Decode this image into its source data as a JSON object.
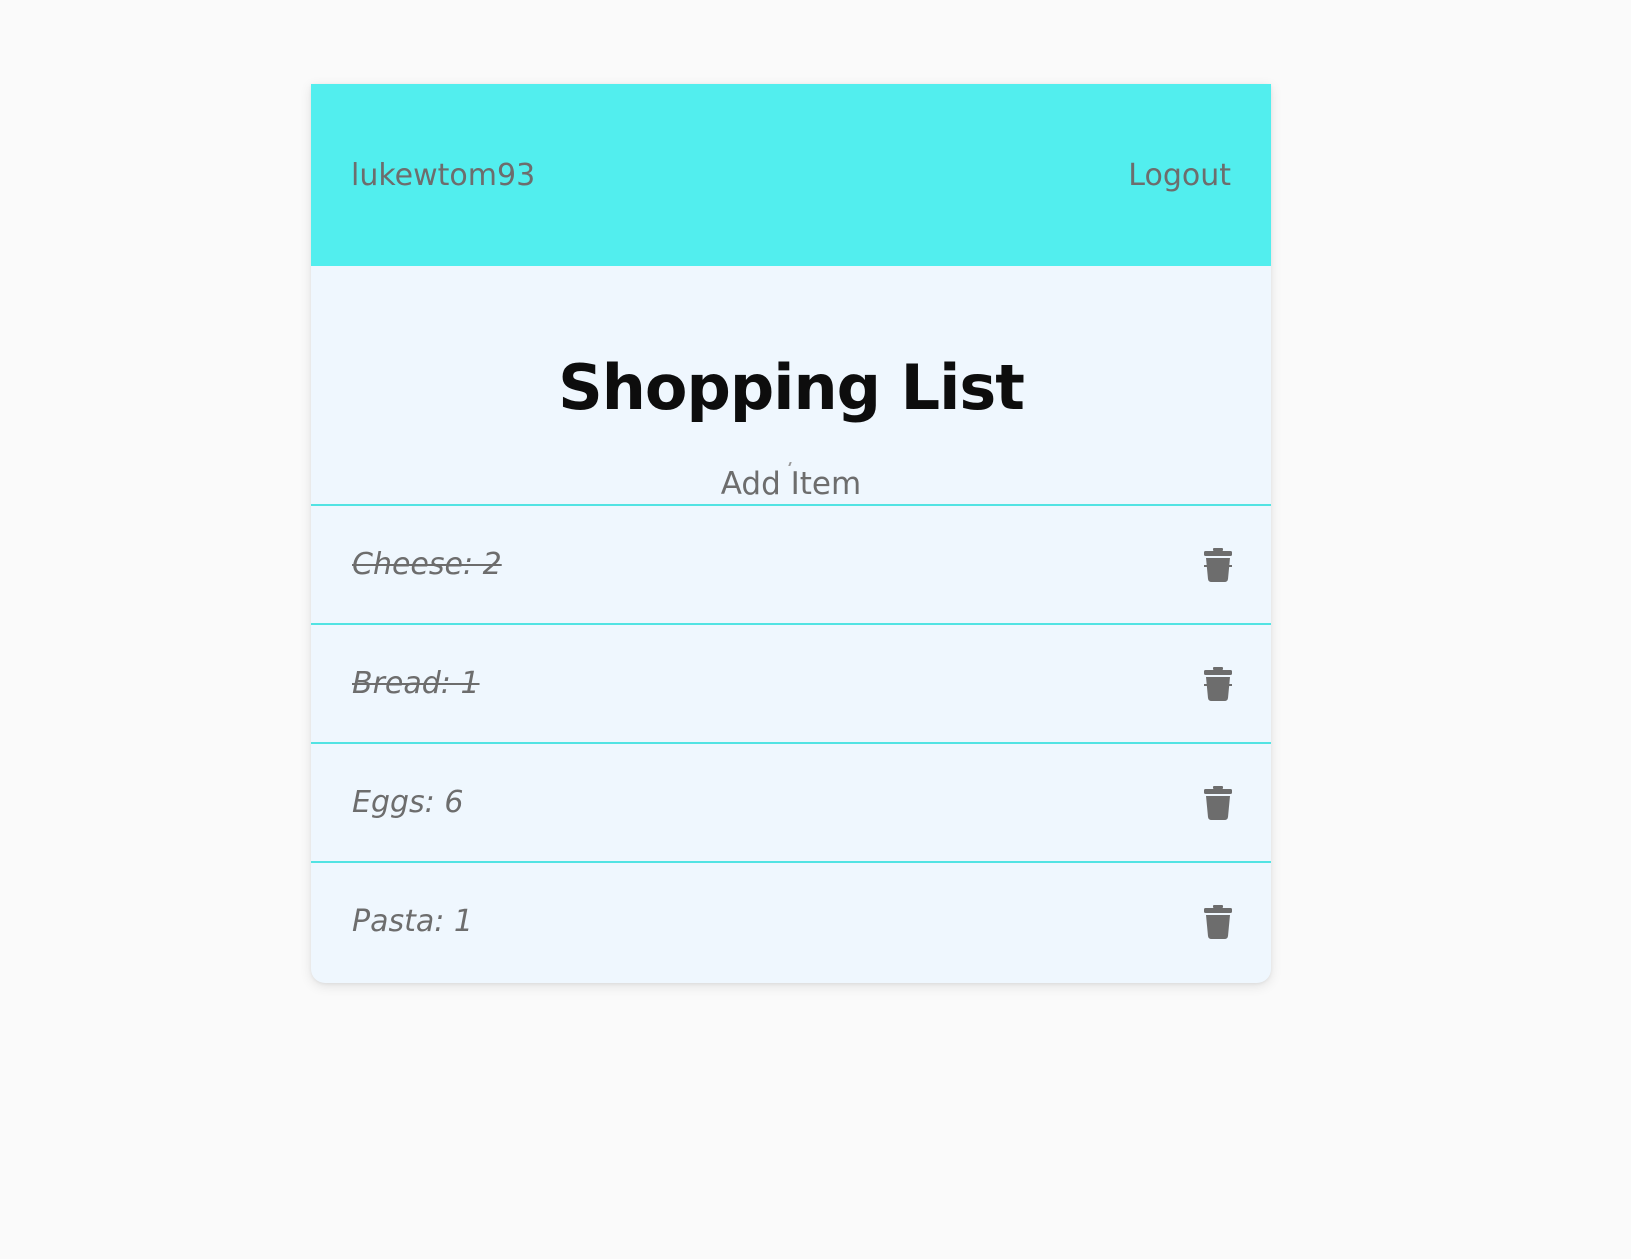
{
  "header": {
    "username": "lukewtom93",
    "logout_label": "Logout"
  },
  "main": {
    "title": "Shopping List",
    "add_item_label": "Add Item"
  },
  "items": [
    {
      "text": "Cheese: 2",
      "done": true,
      "icon": "trash-icon"
    },
    {
      "text": "Bread: 1",
      "done": true,
      "icon": "trash-icon"
    },
    {
      "text": "Eggs: 6",
      "done": false,
      "icon": "trash-icon"
    },
    {
      "text": "Pasta: 1",
      "done": false,
      "icon": "trash-icon"
    }
  ],
  "colors": {
    "header_bg": "#52eeee",
    "card_bg": "#eff7fe",
    "divider": "#52e3e3",
    "muted_text": "#6d6d6d"
  }
}
